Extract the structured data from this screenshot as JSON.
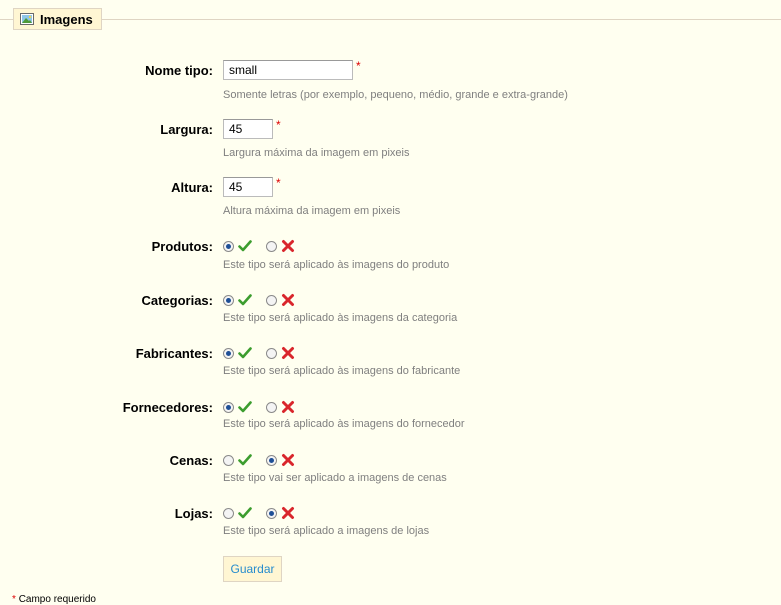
{
  "fieldset": {
    "legend": "Imagens",
    "legend_icon": "image-icon"
  },
  "fields": {
    "name": {
      "label": "Nome tipo:",
      "value": "small",
      "required": "*",
      "hint": "Somente letras (por exemplo, pequeno, médio, grande e extra-grande)"
    },
    "width": {
      "label": "Largura:",
      "value": "45",
      "required": "*",
      "hint": "Largura máxima da imagem em pixeis"
    },
    "height": {
      "label": "Altura:",
      "value": "45",
      "required": "*",
      "hint": "Altura máxima da imagem em pixeis"
    }
  },
  "toggles": [
    {
      "label": "Produtos:",
      "enabled": true,
      "hint": "Este tipo será aplicado às imagens do produto"
    },
    {
      "label": "Categorias:",
      "enabled": true,
      "hint": "Este tipo será aplicado às imagens da categoria"
    },
    {
      "label": "Fabricantes:",
      "enabled": true,
      "hint": "Este tipo será aplicado às imagens do fabricante"
    },
    {
      "label": "Fornecedores:",
      "enabled": true,
      "hint": "Este tipo será aplicado às imagens do fornecedor"
    },
    {
      "label": "Cenas:",
      "enabled": false,
      "hint": "Este tipo vai ser aplicado a imagens de cenas"
    },
    {
      "label": "Lojas:",
      "enabled": false,
      "hint": "Este tipo será aplicado a imagens de lojas"
    }
  ],
  "actions": {
    "save_label": "Guardar"
  },
  "footer": {
    "required_mark": "*",
    "required_text": "Campo requerido"
  },
  "colors": {
    "check": "#3c9d2e",
    "cross": "#d9262c",
    "button_text": "#268ccd"
  }
}
